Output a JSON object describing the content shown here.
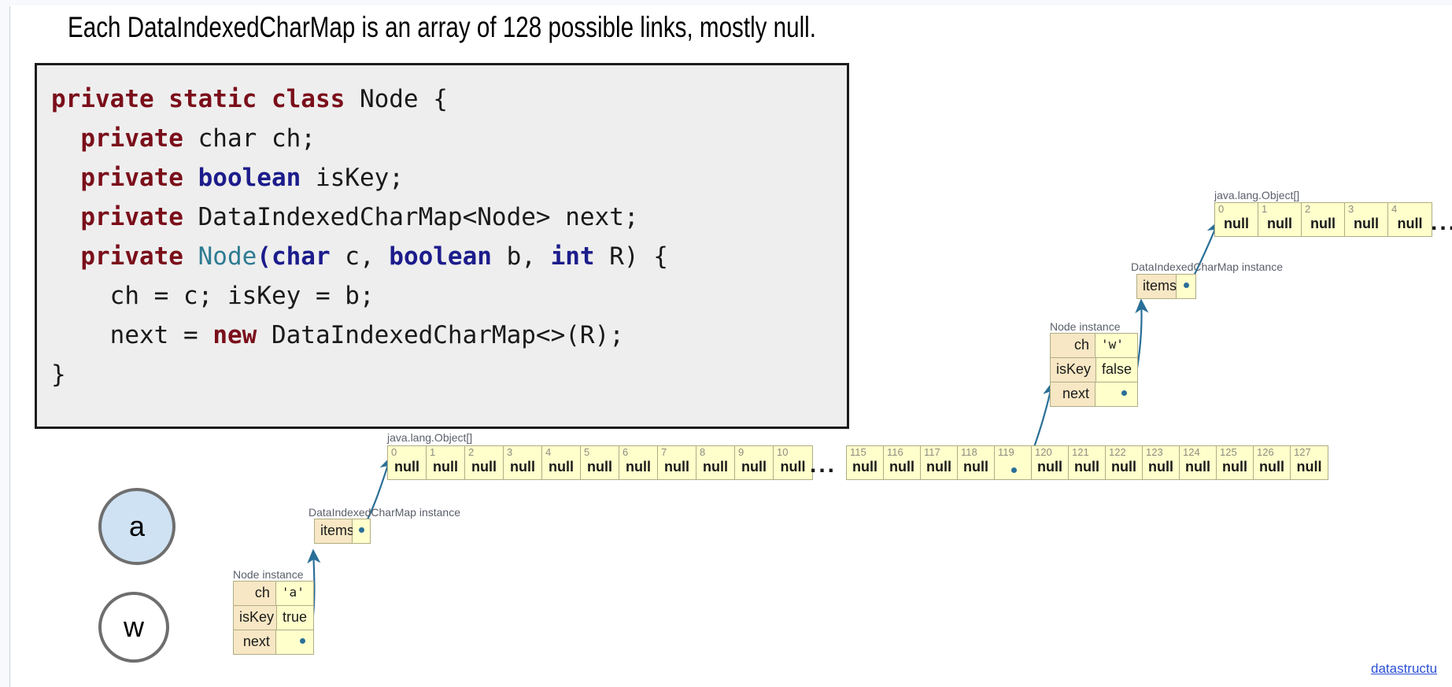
{
  "slide": {
    "title": "Each DataIndexedCharMap is an array of 128 possible links, mostly null.",
    "footer_link": "datastructu"
  },
  "code": {
    "lines": [
      [
        {
          "t": "private static class ",
          "c": "kw"
        },
        {
          "t": "Node {",
          "c": "plain"
        }
      ],
      [
        {
          "t": "  private ",
          "c": "kw"
        },
        {
          "t": "char ch;",
          "c": "plain"
        }
      ],
      [
        {
          "t": "  private ",
          "c": "kw"
        },
        {
          "t": "boolean ",
          "c": "kw2"
        },
        {
          "t": "isKey;",
          "c": "plain"
        }
      ],
      [
        {
          "t": "  private ",
          "c": "kw"
        },
        {
          "t": "DataIndexedCharMap<Node> next;",
          "c": "plain"
        }
      ],
      [
        {
          "t": "  private ",
          "c": "kw"
        },
        {
          "t": "Node",
          "c": "type"
        },
        {
          "t": "(char",
          "c": "kw2"
        },
        {
          "t": " c, ",
          "c": "plain"
        },
        {
          "t": "boolean",
          "c": "kw2"
        },
        {
          "t": " b, ",
          "c": "plain"
        },
        {
          "t": "int",
          "c": "kw2"
        },
        {
          "t": " R) {",
          "c": "plain"
        }
      ],
      [
        {
          "t": "    ch = c; isKey = b;",
          "c": "plain"
        }
      ],
      [
        {
          "t": "    next = ",
          "c": "plain"
        },
        {
          "t": "new ",
          "c": "kw"
        },
        {
          "t": "DataIndexedCharMap<>(R);",
          "c": "plain"
        }
      ],
      [
        {
          "t": "}",
          "c": "plain"
        }
      ]
    ]
  },
  "trie": {
    "nodes": [
      {
        "label": "a",
        "filled": true
      },
      {
        "label": "w",
        "filled": false
      }
    ]
  },
  "diagram_bottom": {
    "node_instance": {
      "caption": "Node instance",
      "fields": [
        {
          "name": "ch",
          "value": "'a'"
        },
        {
          "name": "isKey",
          "value": "true"
        },
        {
          "name": "next",
          "value": ""
        }
      ]
    },
    "dicm_instance": {
      "caption": "DataIndexedCharMap instance",
      "field_name": "items",
      "field_value": ""
    },
    "array": {
      "caption": "java.lang.Object[]",
      "left_indices": [
        "0",
        "1",
        "2",
        "3",
        "4",
        "5",
        "6",
        "7",
        "8",
        "9",
        "10"
      ],
      "left_values": [
        "null",
        "null",
        "null",
        "null",
        "null",
        "null",
        "null",
        "null",
        "null",
        "null",
        "null"
      ],
      "ellipsis": "...",
      "right_indices": [
        "115",
        "116",
        "117",
        "118",
        "119",
        "120",
        "121",
        "122",
        "123",
        "124",
        "125",
        "126",
        "127"
      ],
      "right_values": [
        "null",
        "null",
        "null",
        "null",
        "",
        "null",
        "null",
        "null",
        "null",
        "null",
        "null",
        "null",
        "null"
      ],
      "pointer_index": "119"
    }
  },
  "diagram_top": {
    "node_instance": {
      "caption": "Node instance",
      "fields": [
        {
          "name": "ch",
          "value": "'w'"
        },
        {
          "name": "isKey",
          "value": "false"
        },
        {
          "name": "next",
          "value": ""
        }
      ]
    },
    "dicm_instance": {
      "caption": "DataIndexedCharMap instance",
      "field_name": "items",
      "field_value": ""
    },
    "array": {
      "caption": "java.lang.Object[]",
      "indices": [
        "0",
        "1",
        "2",
        "3",
        "4"
      ],
      "values": [
        "null",
        "null",
        "null",
        "null",
        "null"
      ],
      "ellipsis": "..."
    }
  },
  "colors": {
    "cell_fill": "#ffffcc",
    "field_fill": "#f7e7c4",
    "cell_border": "#b0ad84",
    "arrow": "#2a6f97",
    "code_bg": "#eeeeee",
    "circle_fill": "#cfe2f3",
    "circle_stroke": "#6e6e6e",
    "link": "#2b4fd6"
  }
}
